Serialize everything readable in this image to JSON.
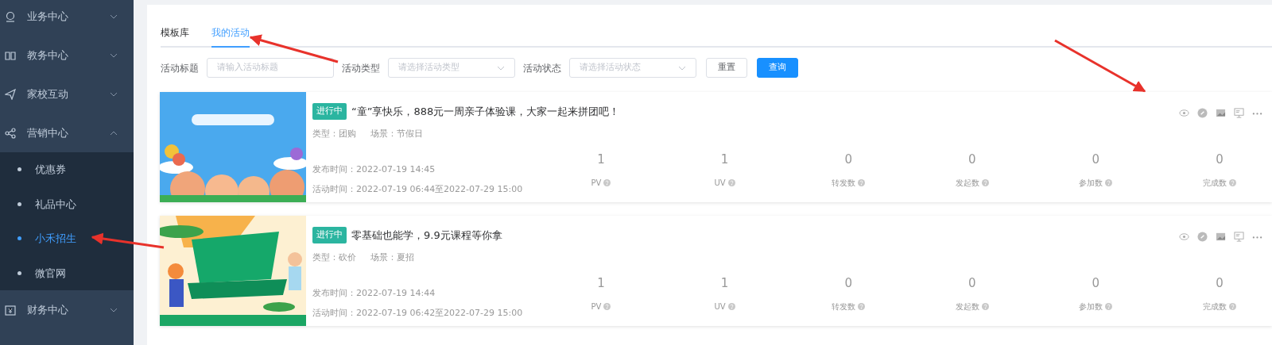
{
  "sidebar": {
    "items": [
      {
        "label": "业务中心",
        "expanded": false,
        "selected": false
      },
      {
        "label": "教务中心",
        "expanded": false,
        "selected": false
      },
      {
        "label": "家校互动",
        "expanded": false,
        "selected": false
      },
      {
        "label": "营销中心",
        "expanded": true,
        "selected": false,
        "children": [
          {
            "label": "优惠券",
            "selected": false
          },
          {
            "label": "礼品中心",
            "selected": false
          },
          {
            "label": "小禾招生",
            "selected": true
          },
          {
            "label": "微官网",
            "selected": false
          }
        ]
      },
      {
        "label": "财务中心",
        "expanded": false,
        "selected": false
      }
    ]
  },
  "tabs": [
    {
      "label": "模板库",
      "selected": false
    },
    {
      "label": "我的活动",
      "selected": true
    }
  ],
  "filters": [
    {
      "kind": "input",
      "label": "活动标题",
      "placeholder": "请输入活动标题"
    },
    {
      "kind": "select",
      "label": "活动类型",
      "placeholder": "请选择活动类型"
    },
    {
      "kind": "select",
      "label": "活动状态",
      "placeholder": "请选择活动状态"
    }
  ],
  "filter_buttons": [
    {
      "kind": "default",
      "label": "重置"
    },
    {
      "kind": "primary",
      "label": "查询"
    }
  ],
  "activities": [
    {
      "status": "进行中",
      "title": "“童”享快乐，888元一周亲子体验课，大家一起来拼团吧！",
      "type": "类型：团购",
      "scene": "场景：节假日",
      "published": "发布时间：2022-07-19 14:45",
      "period": "活动时间：2022-07-19 06:44至2022-07-29 15:00",
      "stats": [
        {
          "value": "1",
          "label": "PV"
        },
        {
          "value": "1",
          "label": "UV"
        },
        {
          "value": "0",
          "label": "转发数"
        },
        {
          "value": "0",
          "label": "发起数"
        },
        {
          "value": "0",
          "label": "参加数"
        },
        {
          "value": "0",
          "label": "完成数"
        }
      ]
    },
    {
      "status": "进行中",
      "title": "零基础也能学，9.9元课程等你拿",
      "type": "类型：砍价",
      "scene": "场景：夏招",
      "published": "发布时间：2022-07-19 14:44",
      "period": "活动时间：2022-07-19 06:42至2022-07-29 15:00",
      "stats": [
        {
          "value": "1",
          "label": "PV"
        },
        {
          "value": "1",
          "label": "UV"
        },
        {
          "value": "0",
          "label": "转发数"
        },
        {
          "value": "0",
          "label": "发起数"
        },
        {
          "value": "0",
          "label": "参加数"
        },
        {
          "value": "0",
          "label": "完成数"
        }
      ]
    }
  ]
}
